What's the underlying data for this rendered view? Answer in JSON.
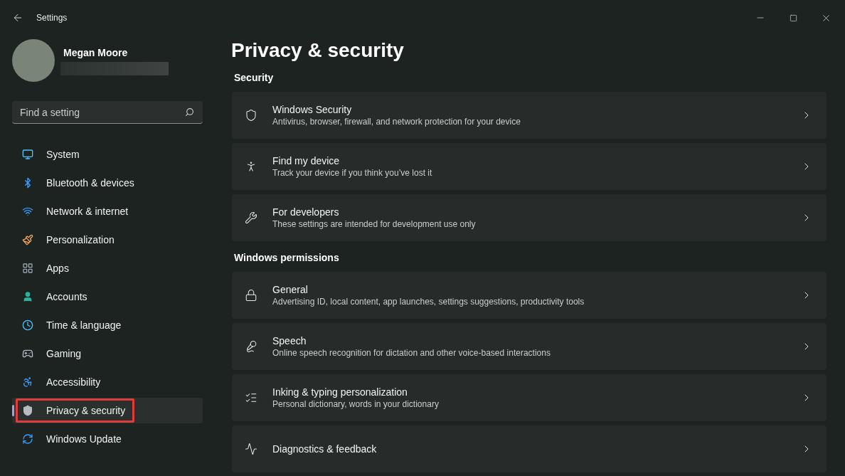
{
  "window": {
    "title": "Settings"
  },
  "profile": {
    "name": "Megan Moore"
  },
  "search": {
    "placeholder": "Find a setting"
  },
  "sidebar": {
    "items": [
      {
        "label": "System",
        "selected": false,
        "annotated": false
      },
      {
        "label": "Bluetooth & devices",
        "selected": false,
        "annotated": false
      },
      {
        "label": "Network & internet",
        "selected": false,
        "annotated": false
      },
      {
        "label": "Personalization",
        "selected": false,
        "annotated": false
      },
      {
        "label": "Apps",
        "selected": false,
        "annotated": false
      },
      {
        "label": "Accounts",
        "selected": false,
        "annotated": false
      },
      {
        "label": "Time & language",
        "selected": false,
        "annotated": false
      },
      {
        "label": "Gaming",
        "selected": false,
        "annotated": false
      },
      {
        "label": "Accessibility",
        "selected": false,
        "annotated": false
      },
      {
        "label": "Privacy & security",
        "selected": true,
        "annotated": true
      },
      {
        "label": "Windows Update",
        "selected": false,
        "annotated": false
      }
    ]
  },
  "page": {
    "title": "Privacy & security",
    "sections": [
      {
        "heading": "Security",
        "items": [
          {
            "title": "Windows Security",
            "subtitle": "Antivirus, browser, firewall, and network protection for your device"
          },
          {
            "title": "Find my device",
            "subtitle": "Track your device if you think you’ve lost it"
          },
          {
            "title": "For developers",
            "subtitle": "These settings are intended for development use only"
          }
        ]
      },
      {
        "heading": "Windows permissions",
        "items": [
          {
            "title": "General",
            "subtitle": "Advertising ID, local content, app launches, settings suggestions, productivity tools"
          },
          {
            "title": "Speech",
            "subtitle": "Online speech recognition for dictation and other voice-based interactions"
          },
          {
            "title": "Inking & typing personalization",
            "subtitle": "Personal dictionary, words in your dictionary"
          },
          {
            "title": "Diagnostics & feedback"
          }
        ]
      }
    ]
  }
}
